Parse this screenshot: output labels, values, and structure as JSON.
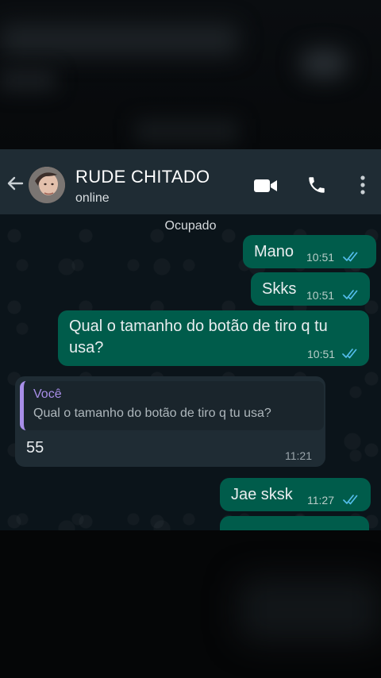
{
  "contact": {
    "name": "RUDE CHITADO",
    "status": "online"
  },
  "header_icons": [
    "back-arrow-icon",
    "video-call-icon",
    "phone-icon",
    "more-menu-icon"
  ],
  "chat": {
    "day_label": "Ocupado",
    "messages": [
      {
        "direction": "out",
        "text": "Mano",
        "time": "10:51",
        "read": true
      },
      {
        "direction": "out",
        "text": "Skks",
        "time": "10:51",
        "read": true
      },
      {
        "direction": "out",
        "text_line1": "Qual o tamanho do botão de tiro q tu",
        "text_line2": "usa?",
        "time": "10:51",
        "read": true
      },
      {
        "direction": "in",
        "quote_author": "Você",
        "quote_text": "Qual o tamanho do botão de tiro q tu usa?",
        "text": "55",
        "time": "11:21"
      },
      {
        "direction": "out",
        "text": "Jae sksk",
        "time": "11:27",
        "read": true
      }
    ]
  },
  "colors": {
    "header": "#1f2c34",
    "outgoing_bubble": "#005c4b",
    "incoming_bubble": "#1f2c34",
    "read_tick": "#53bdeb",
    "quote_accent": "#a88ee8"
  }
}
